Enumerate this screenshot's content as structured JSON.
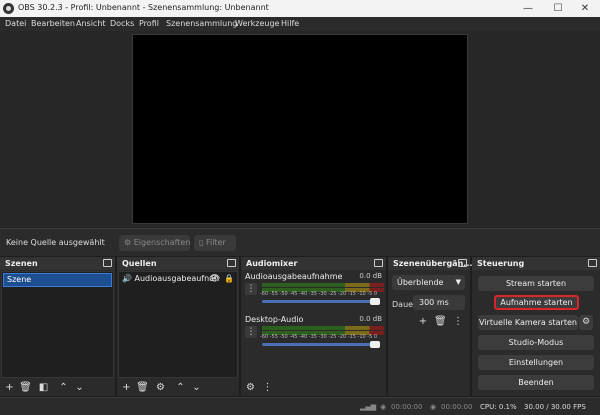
{
  "window": {
    "title": "OBS 30.2.3 - Profil: Unbenannt - Szenensammlung: Unbenannt",
    "minimize": "—",
    "maximize": "☐",
    "close": "✕"
  },
  "menu": [
    "Datei",
    "Bearbeiten",
    "Ansicht",
    "Docks",
    "Profil",
    "Szenensammlung",
    "Werkzeuge",
    "Hilfe"
  ],
  "sourcebar": {
    "no_source": "Keine Quelle ausgewählt",
    "properties": "Eigenschaften",
    "filter": "Filter"
  },
  "docks": {
    "scenes": {
      "title": "Szenen",
      "items": [
        "Szene"
      ]
    },
    "sources": {
      "title": "Quellen",
      "items": [
        "Audioausgabeaufnah"
      ]
    },
    "mixer": {
      "title": "Audiomixer",
      "scale": "-60 -55 -50 -45 -40 -35 -30 -25 -20 -15 -10 -5 0",
      "channels": [
        {
          "name": "Audioausgabeaufnahme",
          "db": "0.0 dB",
          "volume": 1.0
        },
        {
          "name": "Desktop-Audio",
          "db": "0.0 dB",
          "volume": 1.0
        }
      ]
    },
    "transitions": {
      "title": "Szenenübergän...",
      "selected": "Überblende",
      "duration_label": "Dauer",
      "duration_value": "300 ms"
    },
    "controls": {
      "title": "Steuerung",
      "stream": "Stream starten",
      "record": "Aufnahme starten",
      "virtual_cam": "Virtuelle Kamera starten",
      "studio": "Studio-Modus",
      "settings": "Einstellungen",
      "exit": "Beenden"
    }
  },
  "status": {
    "live_time": "00:00:00",
    "rec_time": "00:00:00",
    "cpu": "CPU: 0.1%",
    "fps": "30.00 / 30.00 FPS"
  },
  "colors": {
    "accent_highlight": "#d9262a",
    "selected_scene": "#1d4e8f"
  }
}
